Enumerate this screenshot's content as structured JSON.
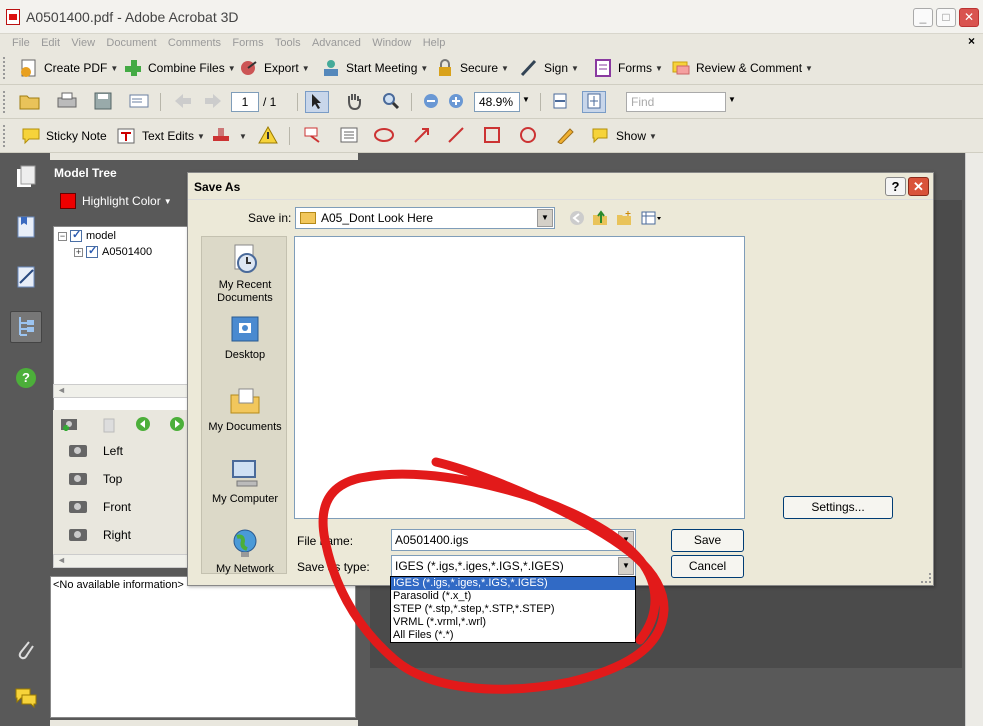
{
  "window": {
    "title": "A0501400.pdf - Adobe Acrobat 3D"
  },
  "menubar": {
    "items": [
      "File",
      "Edit",
      "View",
      "Document",
      "Comments",
      "Forms",
      "Tools",
      "Advanced",
      "Window",
      "Help"
    ],
    "close": "×"
  },
  "toolbar1": {
    "create_pdf": "Create PDF",
    "combine_files": "Combine Files",
    "export": "Export",
    "start_meeting": "Start Meeting",
    "secure": "Secure",
    "sign": "Sign",
    "forms": "Forms",
    "review_comment": "Review & Comment"
  },
  "toolbar2": {
    "page_current": "1",
    "page_total": "/ 1",
    "zoom": "48.9%",
    "find_placeholder": "Find"
  },
  "toolbar3": {
    "sticky_note": "Sticky Note",
    "text_edits": "Text Edits",
    "show": "Show"
  },
  "model_tree": {
    "title": "Model Tree",
    "highlight_color": "Highlight Color",
    "tree": [
      {
        "label": "model",
        "expander": "−"
      },
      {
        "label": "A0501400",
        "expander": "+"
      }
    ],
    "views": [
      "Left",
      "Top",
      "Front",
      "Right"
    ],
    "info": "<No available information>"
  },
  "dialog": {
    "title": "Save As",
    "help": "?",
    "close": "✕",
    "save_in_label": "Save in:",
    "save_in_value": "A05_Dont Look Here",
    "places": [
      {
        "label": "My Recent Documents",
        "icon": "recent-documents-icon"
      },
      {
        "label": "Desktop",
        "icon": "desktop-icon"
      },
      {
        "label": "My Documents",
        "icon": "my-documents-icon"
      },
      {
        "label": "My Computer",
        "icon": "my-computer-icon"
      },
      {
        "label": "My Network",
        "icon": "my-network-icon"
      }
    ],
    "settings": "Settings...",
    "file_name_label": "File name:",
    "file_name_value": "A0501400.igs",
    "save_as_type_label": "Save as type:",
    "save_as_type_value": "IGES (*.igs,*.iges,*.IGS,*.IGES)",
    "save": "Save",
    "cancel": "Cancel",
    "type_options": [
      "IGES (*.igs,*.iges,*.IGS,*.IGES)",
      "Parasolid (*.x_t)",
      "STEP (*.stp,*.step,*.STP,*.STEP)",
      "VRML (*.vrml,*.wrl)",
      "All Files (*.*)"
    ]
  },
  "colors": {
    "annotation": "#e21a1a",
    "selection": "#316ac5",
    "panel": "#595959"
  }
}
